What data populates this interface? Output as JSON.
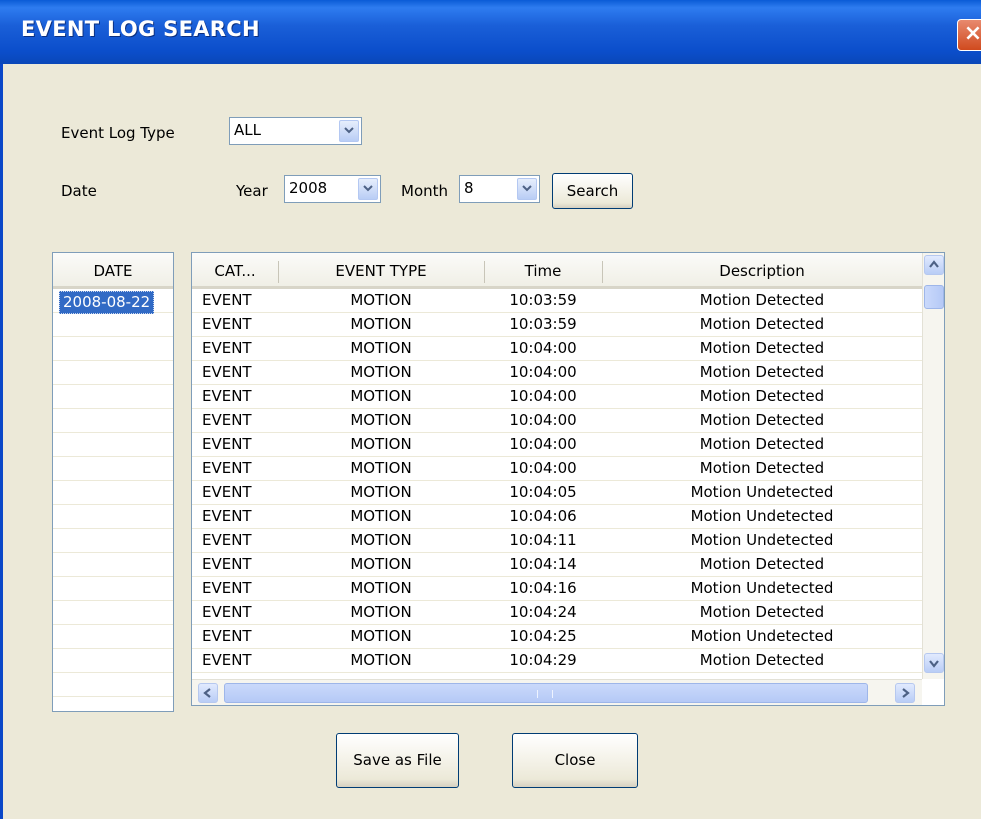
{
  "window": {
    "title": "EVENT LOG SEARCH",
    "close_glyph": "×"
  },
  "filters": {
    "event_log_type_label": "Event Log Type",
    "event_log_type_value": "ALL",
    "date_label": "Date",
    "year_label": "Year",
    "year_value": "2008",
    "month_label": "Month",
    "month_value": "8",
    "search_label": "Search"
  },
  "date_list": {
    "header": "DATE",
    "items": [
      "2008-08-22"
    ],
    "selected_index": 0
  },
  "log_table": {
    "columns": [
      "CAT...",
      "EVENT TYPE",
      "Time",
      "Description"
    ],
    "rows": [
      [
        "EVENT",
        "MOTION",
        "10:03:59",
        "Motion Detected"
      ],
      [
        "EVENT",
        "MOTION",
        "10:03:59",
        "Motion Detected"
      ],
      [
        "EVENT",
        "MOTION",
        "10:04:00",
        "Motion Detected"
      ],
      [
        "EVENT",
        "MOTION",
        "10:04:00",
        "Motion Detected"
      ],
      [
        "EVENT",
        "MOTION",
        "10:04:00",
        "Motion Detected"
      ],
      [
        "EVENT",
        "MOTION",
        "10:04:00",
        "Motion Detected"
      ],
      [
        "EVENT",
        "MOTION",
        "10:04:00",
        "Motion Detected"
      ],
      [
        "EVENT",
        "MOTION",
        "10:04:00",
        "Motion Detected"
      ],
      [
        "EVENT",
        "MOTION",
        "10:04:05",
        "Motion Undetected"
      ],
      [
        "EVENT",
        "MOTION",
        "10:04:06",
        "Motion Undetected"
      ],
      [
        "EVENT",
        "MOTION",
        "10:04:11",
        "Motion Undetected"
      ],
      [
        "EVENT",
        "MOTION",
        "10:04:14",
        "Motion Detected"
      ],
      [
        "EVENT",
        "MOTION",
        "10:04:16",
        "Motion Undetected"
      ],
      [
        "EVENT",
        "MOTION",
        "10:04:24",
        "Motion Detected"
      ],
      [
        "EVENT",
        "MOTION",
        "10:04:25",
        "Motion Undetected"
      ],
      [
        "EVENT",
        "MOTION",
        "10:04:29",
        "Motion Detected"
      ]
    ]
  },
  "buttons": {
    "save_label": "Save as File",
    "close_label": "Close"
  },
  "colors": {
    "titlebar": "#0a5bd6",
    "dialog_bg": "#ece9d8",
    "selection": "#316ac5",
    "close_button": "#d04a1e"
  },
  "icons": {
    "close": "close-icon",
    "dropdown": "chevron-down-icon",
    "scroll_up": "chevron-up-icon",
    "scroll_down": "chevron-down-icon",
    "scroll_left": "chevron-left-icon",
    "scroll_right": "chevron-right-icon"
  }
}
